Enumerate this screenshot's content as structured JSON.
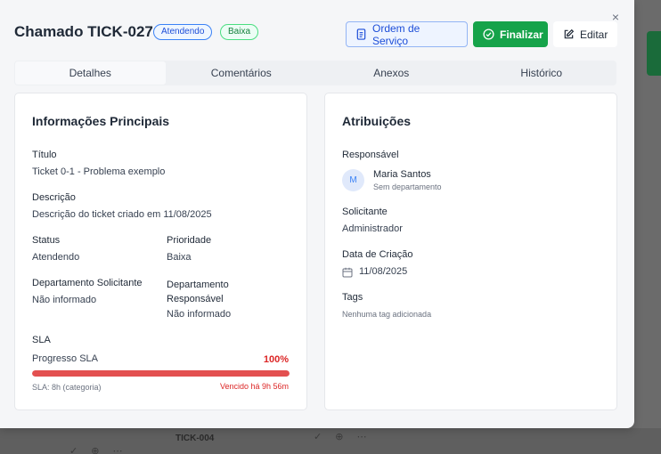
{
  "modal": {
    "title": "Chamado TICK-027",
    "status_badge": "Atendendo",
    "priority_badge": "Baixa",
    "close_label": "×",
    "buttons": {
      "service_order": "Ordem de Serviço",
      "finish": "Finalizar",
      "edit": "Editar"
    },
    "tabs": [
      {
        "label": "Detalhes",
        "active": true
      },
      {
        "label": "Comentários",
        "active": false
      },
      {
        "label": "Anexos",
        "active": false
      },
      {
        "label": "Histórico",
        "active": false
      }
    ]
  },
  "main_info": {
    "heading": "Informações Principais",
    "title_label": "Título",
    "title_value": "Ticket 0-1 - Problema exemplo",
    "description_label": "Descrição",
    "description_value": "Descrição do ticket criado em 11/08/2025",
    "status_label": "Status",
    "status_value": "Atendendo",
    "priority_label": "Prioridade",
    "priority_value": "Baixa",
    "requesting_dept_label": "Departamento Solicitante",
    "requesting_dept_value": "Não informado",
    "responsible_dept_label": "Departamento Responsável",
    "responsible_dept_value": "Não informado",
    "sla": {
      "label": "SLA",
      "progress_label": "Progresso SLA",
      "progress_text": "100%",
      "progress_fraction": 1.0,
      "category_text": "SLA: 8h (categoria)",
      "overdue_text": "Vencido há 9h 56m"
    }
  },
  "assignments": {
    "heading": "Atribuições",
    "responsible_label": "Responsável",
    "avatar_initial": "M",
    "responsible_name": "Maria Santos",
    "responsible_dept": "Sem departamento",
    "requester_label": "Solicitante",
    "requester_value": "Administrador",
    "created_label": "Data de Criação",
    "created_value": "11/08/2025",
    "tags_label": "Tags",
    "tags_empty": "Nenhuma tag adicionada"
  },
  "background": {
    "row_ticket": "TICK-004",
    "row_actions": "✓ ⊕ ⋯"
  },
  "colors": {
    "primary": "#1d4ed8",
    "success": "#16a34a",
    "danger": "#dc2626"
  }
}
